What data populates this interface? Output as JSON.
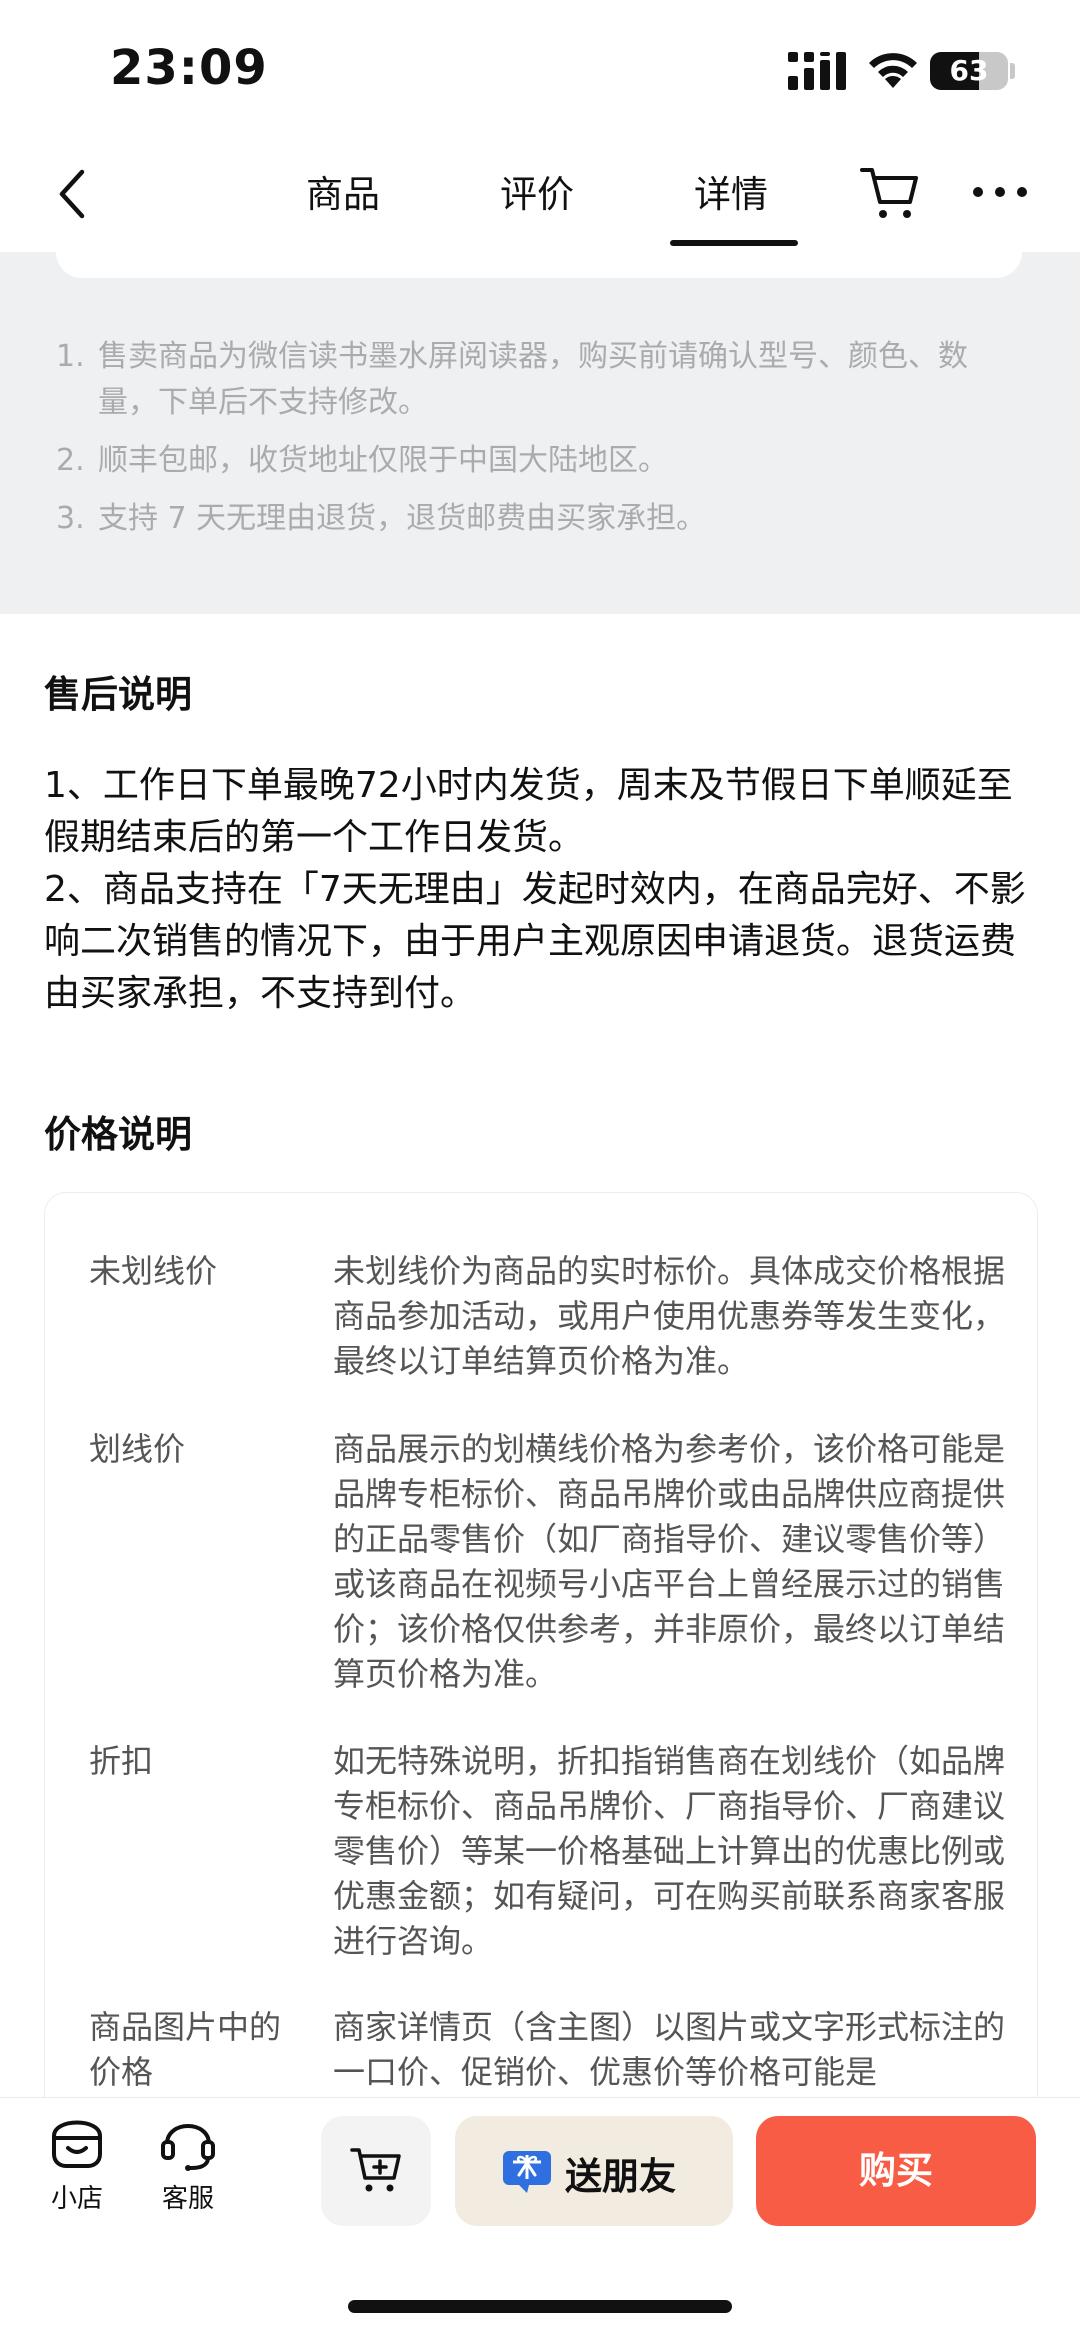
{
  "status_bar": {
    "time": "23:09",
    "battery": "63",
    "battery_level_percent": 63
  },
  "nav": {
    "tabs": [
      {
        "label": "商品",
        "active": false
      },
      {
        "label": "评价",
        "active": false
      },
      {
        "label": "详情",
        "active": true
      }
    ],
    "icons": [
      "back-icon",
      "cart-icon",
      "more-icon"
    ]
  },
  "notice": {
    "items": [
      {
        "num": "1.",
        "text": "售卖商品为微信读书墨水屏阅读器，购买前请确认型号、颜色、数量，下单后不支持修改。"
      },
      {
        "num": "2.",
        "text": "顺丰包邮，收货地址仅限于中国大陆地区。"
      },
      {
        "num": "3.",
        "text": "支持 7 天无理由退货，退货邮费由买家承担。"
      }
    ]
  },
  "after_sales": {
    "title": "售后说明",
    "paragraphs": [
      "1、工作日下单最晚72小时内发货，周末及节假日下单顺延至假期结束后的第一个工作日发货。",
      "2、商品支持在「7天无理由」发起时效内，在商品完好、不影响二次销售的情况下，由于用户主观原因申请退货。退货运费由买家承担，不支持到付。"
    ]
  },
  "price_info": {
    "title": "价格说明",
    "rows": [
      {
        "term": "未划线价",
        "desc": "未划线价为商品的实时标价。具体成交价格根据商品参加活动，或用户使用优惠券等发生变化，最终以订单结算页价格为准。"
      },
      {
        "term": "划线价",
        "desc": "商品展示的划横线价格为参考价，该价格可能是品牌专柜标价、商品吊牌价或由品牌供应商提供的正品零售价（如厂商指导价、建议零售价等）或该商品在视频号小店平台上曾经展示过的销售价；该价格仅供参考，并非原价，最终以订单结算页价格为准。"
      },
      {
        "term": "折扣",
        "desc": "如无特殊说明，折扣指销售商在划线价（如品牌专柜标价、商品吊牌价、厂商指导价、厂商建议零售价）等某一价格基础上计算出的优惠比例或优惠金额；如有疑问，可在购买前联系商家客服进行咨询。"
      },
      {
        "term": "商品图片中的价格",
        "desc": "商家详情页（含主图）以图片或文字形式标注的一口价、促销价、优惠价等价格可能是"
      }
    ]
  },
  "bottom_bar": {
    "shop_label": "小店",
    "service_label": "客服",
    "gift_label": "送朋友",
    "buy_label": "购买",
    "colors": {
      "buy": "#f85c44",
      "gift_bg": "#f1ebe0",
      "gift_icon": "#2f6fe0"
    }
  }
}
